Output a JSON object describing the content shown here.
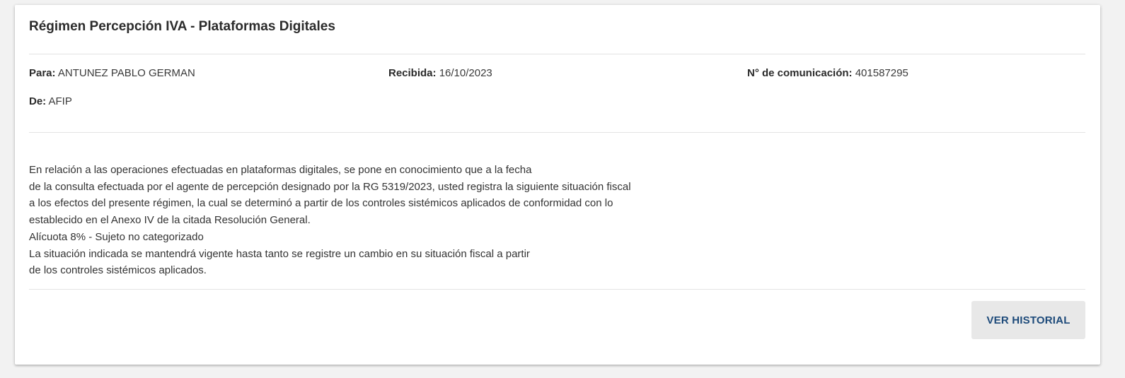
{
  "message": {
    "title": "Régimen Percepción IVA - Plataformas Digitales",
    "para_label": "Para:",
    "para_value": "ANTUNEZ PABLO GERMAN",
    "recibida_label": "Recibida:",
    "recibida_value": "16/10/2023",
    "numero_label": "N° de comunicación:",
    "numero_value": "401587295",
    "de_label": "De:",
    "de_value": "AFIP",
    "body_lines": [
      "En relación a las operaciones efectuadas en plataformas digitales, se pone en conocimiento que a la fecha",
      "de la consulta efectuada por el agente de percepción designado por la RG 5319/2023, usted registra la siguiente situación fiscal",
      "a los efectos del presente régimen, la cual se determinó a partir de los controles sistémicos aplicados de conformidad con lo",
      "establecido en el Anexo IV de la citada Resolución General.",
      "Alícuota 8% - Sujeto no categorizado",
      "La situación indicada se mantendrá vigente hasta tanto se registre un cambio en su situación fiscal a partir",
      "de los controles sistémicos aplicados."
    ]
  },
  "actions": {
    "ver_historial_label": "VER HISTORIAL"
  },
  "colors": {
    "page_background": "#f2f2f2",
    "card_background": "#ffffff",
    "button_background": "#e8e8e8",
    "button_text": "#1d4a7a",
    "divider": "#e3e3e3"
  }
}
